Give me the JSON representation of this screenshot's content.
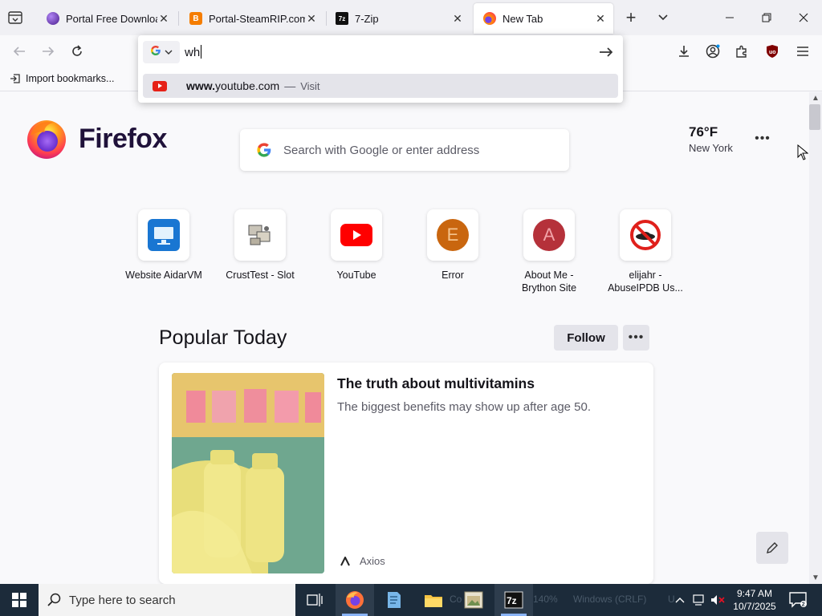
{
  "browser": {
    "tabs": [
      {
        "title": "Portal Free Download (",
        "favicon": "purple-orb-icon",
        "active": false
      },
      {
        "title": "Portal-SteamRIP.com.ra",
        "favicon": "blogger-b-icon",
        "active": false
      },
      {
        "title": "7-Zip",
        "favicon": "7zip-icon",
        "active": false
      },
      {
        "title": "New Tab",
        "favicon": "firefox-icon",
        "active": true
      }
    ],
    "urlbar": {
      "typed_text": "wh",
      "engine": "G"
    },
    "suggestion": {
      "url_bold": "www.",
      "url_rest": "youtube.com",
      "separator": "—",
      "action": "Visit"
    },
    "bookmarks": {
      "import_label": "Import bookmarks..."
    }
  },
  "newtab": {
    "logo_text": "Firefox",
    "search_placeholder": "Search with Google or enter address",
    "weather": {
      "temp": "76°F",
      "city": "New York"
    },
    "top_sites": [
      {
        "label": "Website AidarVM",
        "icon": "monitor-icon"
      },
      {
        "label": "CrustTest - Slot",
        "icon": "computer-stack-icon"
      },
      {
        "label": "YouTube",
        "icon": "youtube-icon"
      },
      {
        "label": "Error",
        "icon": "letter-e-icon",
        "letter": "E",
        "color": "#c9660f"
      },
      {
        "label": "About Me -\nBrython Site",
        "icon": "letter-a-icon",
        "letter": "A",
        "color": "#b5313a"
      },
      {
        "label": "elijahr -\nAbuseIPDB Us...",
        "icon": "no-hat-icon"
      }
    ],
    "popular": {
      "title": "Popular Today",
      "follow_label": "Follow",
      "story": {
        "headline": "The truth about multivitamins",
        "description": "The biggest benefits may show up after age 50.",
        "source": "Axios"
      }
    }
  },
  "taskbar": {
    "search_placeholder": "Type here to search",
    "ghost_text": [
      "Co",
      "140%",
      "Windows (CRLF)",
      "U"
    ],
    "clock_time": "9:47 AM",
    "clock_date": "10/7/2025"
  },
  "colors": {
    "firefox_purple": "#20123a",
    "taskbar_bg": "#1c2b3a",
    "youtube_red": "#e62117"
  }
}
